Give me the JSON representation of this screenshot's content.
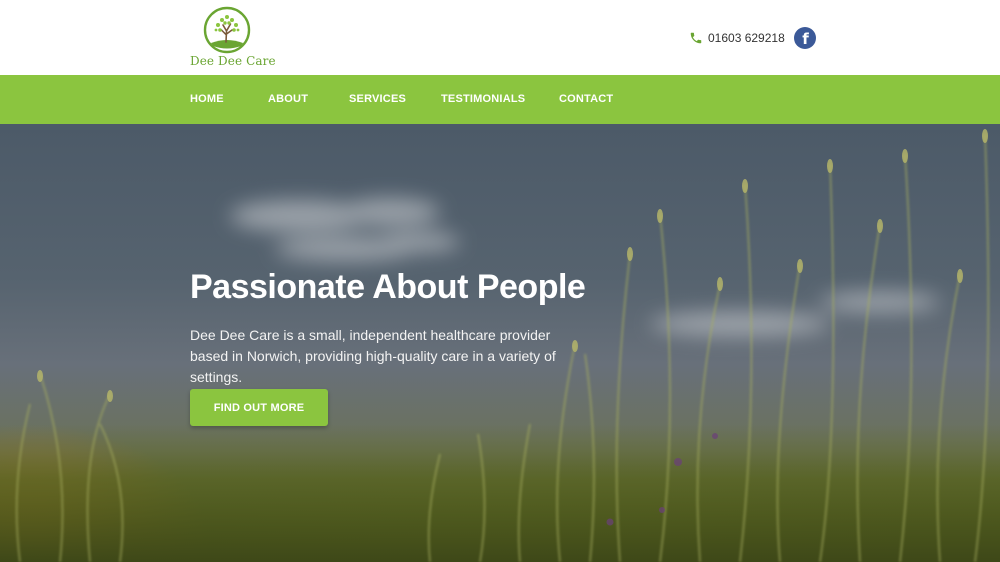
{
  "brand": {
    "name": "Dee Dee Care",
    "logo_icon": "tree-icon",
    "accent_color": "#8bc53f",
    "logo_text_color": "#6aa532"
  },
  "header": {
    "phone": "01603 629218",
    "phone_icon": "phone-icon",
    "social_icon": "facebook-icon",
    "facebook_color": "#3b5998"
  },
  "nav": {
    "items": [
      {
        "label": "HOME"
      },
      {
        "label": "ABOUT"
      },
      {
        "label": "SERVICES"
      },
      {
        "label": "TESTIMONIALS"
      },
      {
        "label": "CONTACT"
      }
    ]
  },
  "hero": {
    "title": "Passionate About People",
    "description": "Dee Dee Care is a small, independent healthcare provider based in Norwich, providing high-quality care in a variety of settings.",
    "button_label": "FIND OUT MORE",
    "background": "grass field against cloudy sky"
  }
}
